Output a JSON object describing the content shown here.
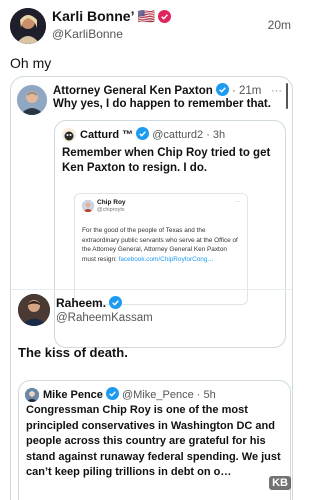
{
  "top_post": {
    "name": "Karli Bonne’ 🇺🇸",
    "handle": "@KarliBonne",
    "time": "20m",
    "text": "Oh my"
  },
  "paxton_post": {
    "name": "Attorney General Ken Paxton",
    "time": "· 21m",
    "text": "Why yes, I do happen to remember that.",
    "more": "···"
  },
  "catturd_post": {
    "name": "Catturd ™",
    "handle_time": "@catturd2 · 3h",
    "text": "Remember when Chip Roy tried to get Ken Paxton to resign. I do."
  },
  "chip_post": {
    "name": "Chip Roy",
    "handle": "@chiproytx",
    "more": "···",
    "body": "For the good of the people of Texas and the extraordinary public servants who serve at the Office of the Attorney General, Attorney General Ken Paxton must resign: ",
    "link": "facebook.com/ChipRoyforCong…"
  },
  "raheem_post": {
    "name": "Raheem.",
    "handle": "@RaheemKassam",
    "text": "The kiss of death."
  },
  "pence_post": {
    "name": "Mike Pence",
    "handle_time": "@Mike_Pence · 5h",
    "text": "Congressman Chip Roy is one of the most principled conservatives in Washington DC and people across this country are grateful for his stand against runaway federal spending. We just can’t keep piling trillions in debt on o…"
  },
  "watermark": "KB",
  "colors": {
    "verified_blue": "#1d9bf0",
    "verified_red": "#e0245e",
    "link": "#1d9bf0"
  }
}
